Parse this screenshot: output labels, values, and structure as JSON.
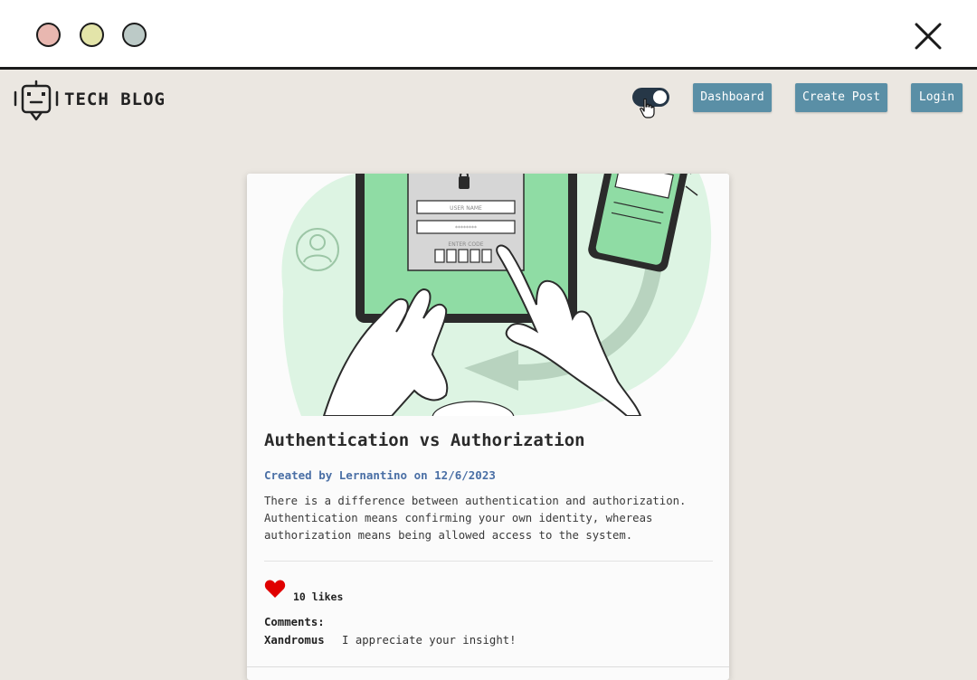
{
  "window": {
    "controls": [
      "close-dot",
      "minimize-dot",
      "maximize-dot"
    ],
    "close_icon": "close-icon"
  },
  "header": {
    "logo_icon": "robot-chat-icon",
    "brand": "TECH BLOG",
    "theme_toggle": {
      "state": "on",
      "icon": "toggle-switch-icon"
    },
    "nav": {
      "dashboard": "Dashboard",
      "create_post": "Create Post",
      "login": "Login"
    }
  },
  "post": {
    "image_icon": "authentication-illustration",
    "image_text": {
      "username_placeholder": "USER NAME",
      "password_placeholder": "********",
      "code_label": "ENTER CODE"
    },
    "title": "Authentication vs Authorization",
    "meta": "Created by Lernantino on 12/6/2023",
    "body": "There is a difference between authentication and authorization. Authentication means confirming your own identity, whereas authorization means being allowed access to the system.",
    "likes": "10 likes",
    "comments_label": "Comments:",
    "comments": [
      {
        "author": "Xandromus",
        "text": "I appreciate your insight!"
      }
    ]
  },
  "colors": {
    "background": "#ebe7e1",
    "button": "#5a8fa6",
    "meta_link": "#4a6fa5",
    "heart": "#e00000",
    "illustration_green": "#8fdca4"
  }
}
